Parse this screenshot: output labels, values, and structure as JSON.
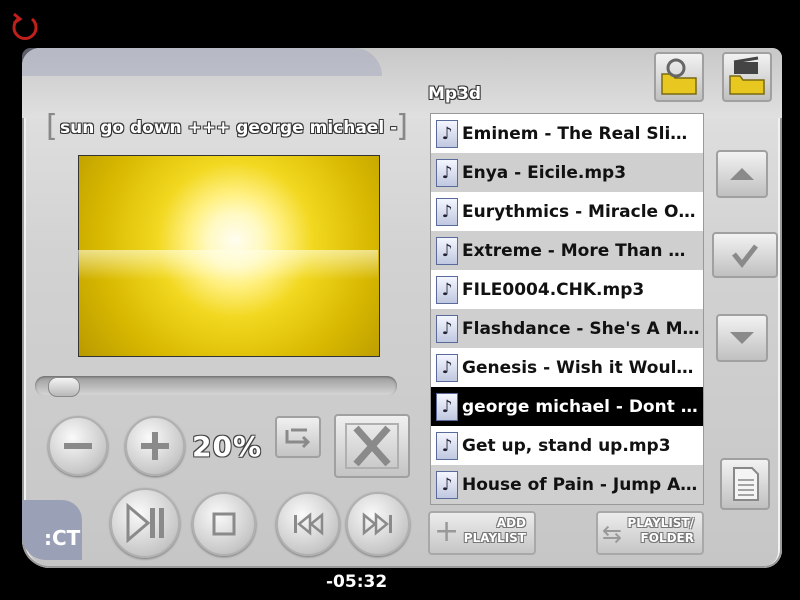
{
  "player": {
    "now_playing": "sun go down +++ george michael - Dont let the sun go down",
    "volume": "20%",
    "time": "-05:32",
    "brand": ":CT",
    "seek_progress": 0.03
  },
  "playlist": {
    "folder_label": "Mp3d",
    "items": [
      {
        "label": "Eminem - The Real Slim..."
      },
      {
        "label": "Enya - Eicile.mp3"
      },
      {
        "label": "Eurythmics - Miracle Of ..."
      },
      {
        "label": "Extreme - More Than W..."
      },
      {
        "label": "FILE0004.CHK.mp3"
      },
      {
        "label": "Flashdance - She's A Ma..."
      },
      {
        "label": "Genesis - Wish it Would ..."
      },
      {
        "label": "george michael - Dont l..."
      },
      {
        "label": "Get up, stand up.mp3"
      },
      {
        "label": "House of Pain - Jump Ar..."
      }
    ],
    "selected_index": 7,
    "add_button": {
      "line1": "ADD",
      "line2": "PLAYLIST"
    },
    "switch_button": {
      "line1": "PLAYLIST/",
      "line2": "FOLDER"
    }
  },
  "icons": {
    "power": "power-icon",
    "volume_down": "minus-icon",
    "volume_up": "plus-icon",
    "repeat": "repeat-icon",
    "shuffle_off": "shuffle-disabled-icon",
    "play_pause": "play-pause-icon",
    "stop": "stop-icon",
    "prev": "previous-icon",
    "next": "next-icon",
    "scroll_up": "arrow-up-icon",
    "confirm": "checkmark-icon",
    "scroll_down": "arrow-down-icon",
    "document": "document-icon",
    "music_folder": "music-folder-icon",
    "video_folder": "video-folder-icon"
  },
  "colors": {
    "selected_row_bg": "#000000",
    "alt_row_bg": "#cfcfcf",
    "power_red": "#c0201c"
  }
}
